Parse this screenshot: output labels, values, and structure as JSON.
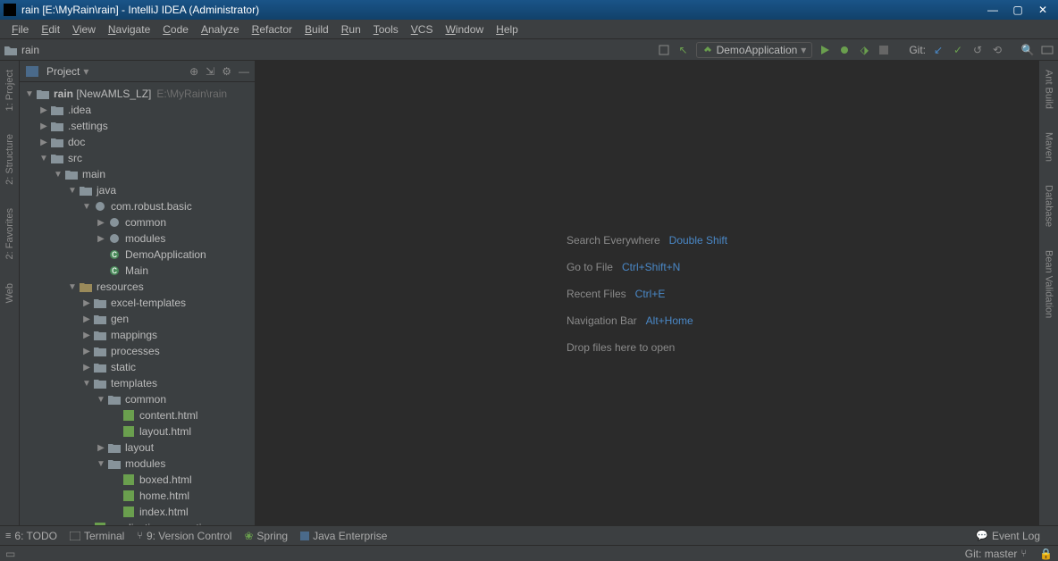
{
  "window": {
    "title": "rain [E:\\MyRain\\rain] - IntelliJ IDEA (Administrator)"
  },
  "menu": [
    "File",
    "Edit",
    "View",
    "Navigate",
    "Code",
    "Analyze",
    "Refactor",
    "Build",
    "Run",
    "Tools",
    "VCS",
    "Window",
    "Help"
  ],
  "breadcrumb": {
    "root": "rain"
  },
  "run": {
    "config": "DemoApplication",
    "git": "Git:"
  },
  "panel": {
    "title": "Project"
  },
  "tree": {
    "root": {
      "name": "rain",
      "lib": "[NewAMLS_LZ]",
      "path": "E:\\MyRain\\rain"
    },
    "nodes": [
      {
        "d": 1,
        "a": "▶",
        "t": "folder",
        "l": ".idea"
      },
      {
        "d": 1,
        "a": "▶",
        "t": "folder",
        "l": ".settings"
      },
      {
        "d": 1,
        "a": "▶",
        "t": "folder",
        "l": "doc"
      },
      {
        "d": 1,
        "a": "▼",
        "t": "folder",
        "l": "src"
      },
      {
        "d": 2,
        "a": "▼",
        "t": "folder",
        "l": "main"
      },
      {
        "d": 3,
        "a": "▼",
        "t": "folder",
        "l": "java"
      },
      {
        "d": 4,
        "a": "▼",
        "t": "pkg",
        "l": "com.robust.basic"
      },
      {
        "d": 5,
        "a": "▶",
        "t": "pkg",
        "l": "common"
      },
      {
        "d": 5,
        "a": "▶",
        "t": "pkg",
        "l": "modules"
      },
      {
        "d": 5,
        "a": "",
        "t": "class",
        "l": "DemoApplication"
      },
      {
        "d": 5,
        "a": "",
        "t": "class",
        "l": "Main"
      },
      {
        "d": 3,
        "a": "▼",
        "t": "res",
        "l": "resources"
      },
      {
        "d": 4,
        "a": "▶",
        "t": "folder",
        "l": "excel-templates"
      },
      {
        "d": 4,
        "a": "▶",
        "t": "folder",
        "l": "gen"
      },
      {
        "d": 4,
        "a": "▶",
        "t": "folder",
        "l": "mappings"
      },
      {
        "d": 4,
        "a": "▶",
        "t": "folder",
        "l": "processes"
      },
      {
        "d": 4,
        "a": "▶",
        "t": "folder",
        "l": "static"
      },
      {
        "d": 4,
        "a": "▼",
        "t": "folder",
        "l": "templates"
      },
      {
        "d": 5,
        "a": "▼",
        "t": "folder",
        "l": "common"
      },
      {
        "d": 6,
        "a": "",
        "t": "html",
        "l": "content.html"
      },
      {
        "d": 6,
        "a": "",
        "t": "html",
        "l": "layout.html"
      },
      {
        "d": 5,
        "a": "▶",
        "t": "folder",
        "l": "layout"
      },
      {
        "d": 5,
        "a": "▼",
        "t": "folder",
        "l": "modules"
      },
      {
        "d": 6,
        "a": "",
        "t": "html",
        "l": "boxed.html"
      },
      {
        "d": 6,
        "a": "",
        "t": "html",
        "l": "home.html"
      },
      {
        "d": 6,
        "a": "",
        "t": "html",
        "l": "index.html"
      },
      {
        "d": 4,
        "a": "",
        "t": "prop",
        "l": "application.properties"
      }
    ]
  },
  "welcome": [
    {
      "label": "Search Everywhere",
      "key": "Double Shift",
      "link": true
    },
    {
      "label": "Go to File",
      "key": "Ctrl+Shift+N",
      "link": true
    },
    {
      "label": "Recent Files",
      "key": "Ctrl+E",
      "link": true
    },
    {
      "label": "Navigation Bar",
      "key": "Alt+Home",
      "link": true
    },
    {
      "label": "Drop files here to open",
      "key": "",
      "link": false
    }
  ],
  "left_tabs": [
    "1: Project",
    "2: Structure",
    "2: Favorites",
    "Web"
  ],
  "right_tabs": [
    "Ant Build",
    "Maven",
    "Database",
    "Bean Validation"
  ],
  "status": {
    "todo": "6: TODO",
    "terminal": "Terminal",
    "vc": "9: Version Control",
    "spring": "Spring",
    "je": "Java Enterprise",
    "eventlog": "Event Log",
    "gitbranch": "Git: master"
  }
}
